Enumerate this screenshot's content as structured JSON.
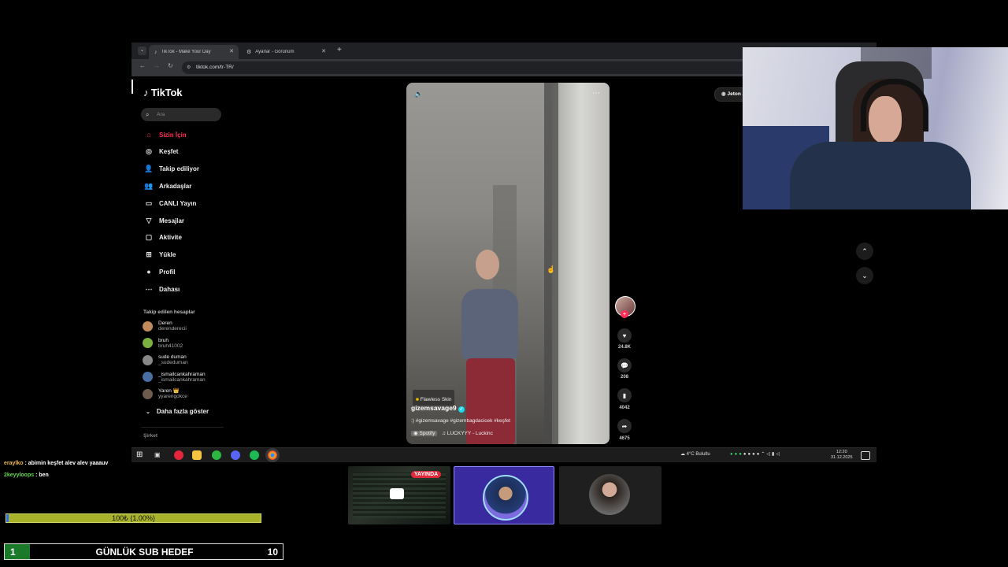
{
  "browser": {
    "tabs": [
      {
        "label": "TikTok - Make Your Day",
        "active": true
      },
      {
        "label": "Ayarlar - Görünüm",
        "active": false
      }
    ],
    "new_tab": "+",
    "url": "tiktok.com/tr-TR/"
  },
  "tiktok": {
    "logo": "TikTok",
    "search_placeholder": "Ara",
    "menu": [
      {
        "label": "Sizin İçin",
        "icon": "home-icon",
        "active": true
      },
      {
        "label": "Keşfet",
        "icon": "compass-icon"
      },
      {
        "label": "Takip ediliyor",
        "icon": "following-icon"
      },
      {
        "label": "Arkadaşlar",
        "icon": "friends-icon"
      },
      {
        "label": "CANLI Yayın",
        "icon": "live-icon"
      },
      {
        "label": "Mesajlar",
        "icon": "messages-icon"
      },
      {
        "label": "Aktivite",
        "icon": "activity-icon"
      },
      {
        "label": "Yükle",
        "icon": "upload-icon"
      },
      {
        "label": "Profil",
        "icon": "profile-icon"
      },
      {
        "label": "Dahası",
        "icon": "more-icon"
      }
    ],
    "following_title": "Takip edilen hesaplar",
    "following": [
      {
        "name": "Deren",
        "user": "derenderecii",
        "color": "#c08a5a"
      },
      {
        "name": "bruh",
        "user": "bruh41002",
        "color": "#7ab03f"
      },
      {
        "name": "sude duman",
        "user": "_sudeduman",
        "color": "#888888"
      },
      {
        "name": "_ismailcankahraman",
        "user": "_ismailcankahraman",
        "color": "#4a6fa5"
      },
      {
        "name": "Yaren 👑",
        "user": "yyarengokce",
        "color": "#6e5b4d"
      }
    ],
    "show_more": "Daha fazla göster",
    "company": "Şirket",
    "coins_pill": "Jeton al",
    "video": {
      "effect_tag": "Flawless Skin",
      "username": "gizemsavage9",
      "caption": ":) #gizemsavage #gizembagdacicek #keşfet",
      "music_src": "Spotify",
      "music": "LUCKYYY - Luckinc"
    },
    "actions": {
      "likes": "24.8K",
      "comments": "208",
      "saves": "4042",
      "shares": "4675"
    }
  },
  "taskbar": {
    "weather": "4°C Bulutlu",
    "time": "12:20",
    "date": "31.12.2025"
  },
  "stream": {
    "chat": [
      {
        "user": "eraylko",
        "user_color": "#f0b84a",
        "text": " : abimin keşfet alev alev yaaauv"
      },
      {
        "user": "2keyyloops",
        "user_color": "#61d94a",
        "text": " : ben"
      }
    ],
    "goal_text": "100₺ (1.00%)",
    "goal_progress": 0.01,
    "sub_goal": {
      "current": "1",
      "label": "GÜNLÜK SUB HEDEF",
      "target": "10"
    },
    "live_badge": "YAYINDA"
  }
}
